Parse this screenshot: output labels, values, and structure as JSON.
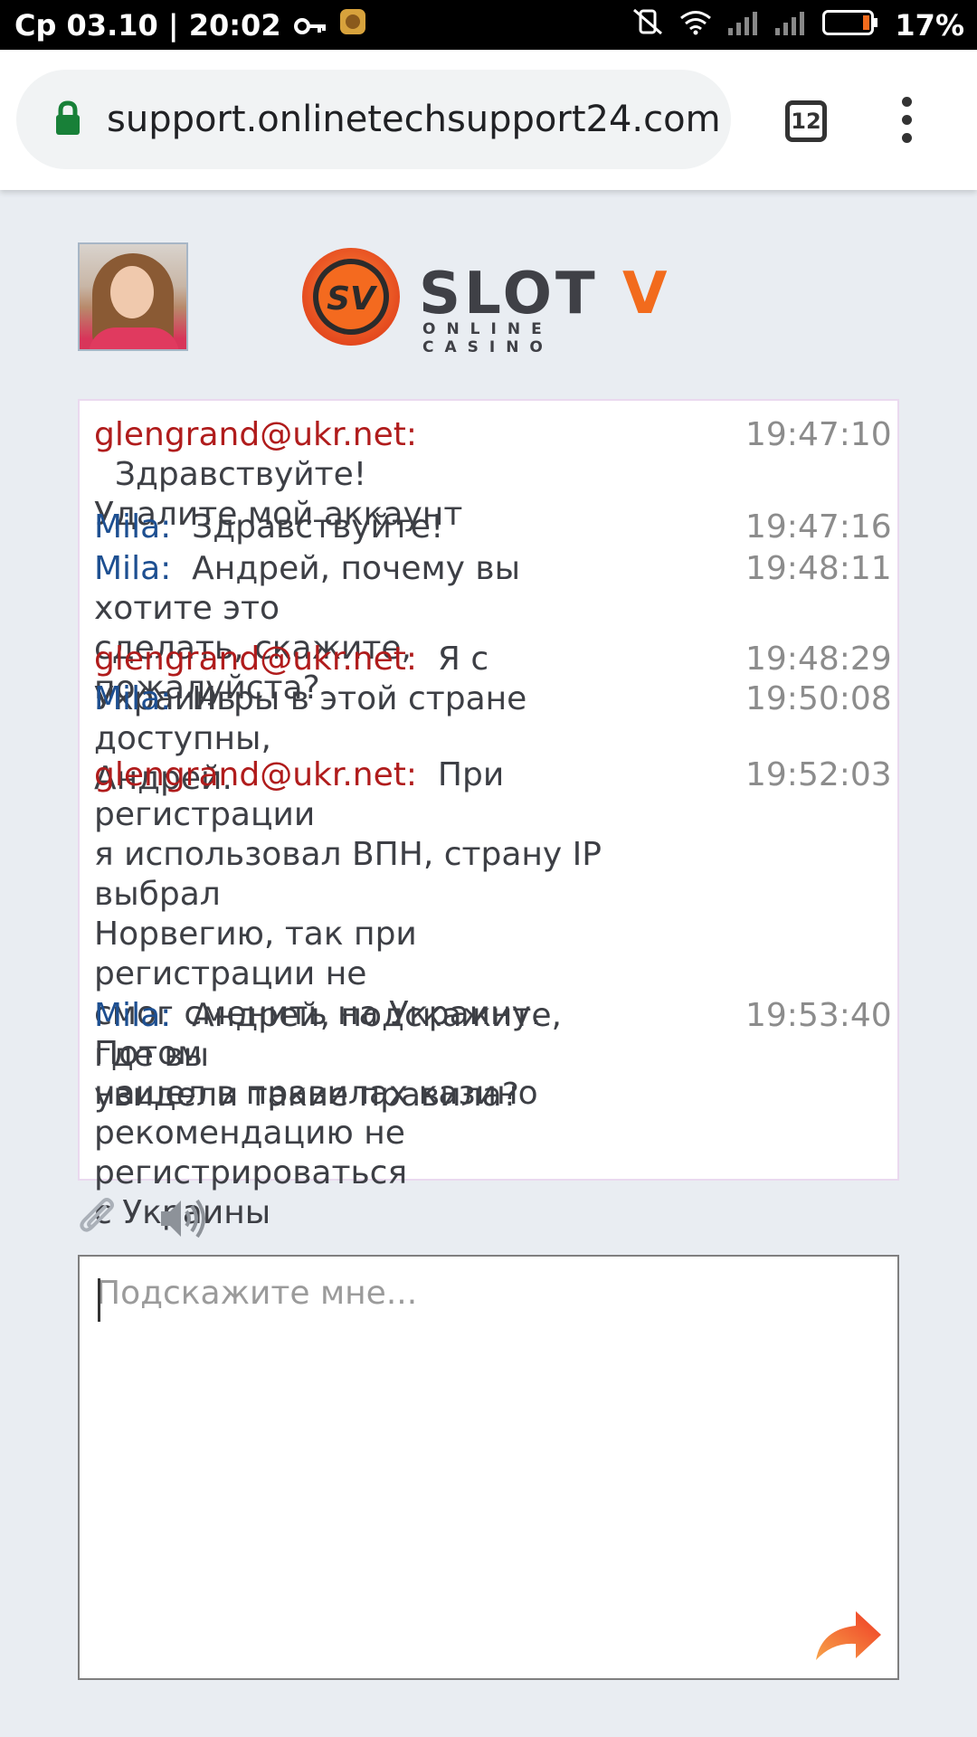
{
  "status_bar": {
    "time": "Ср 03.10 | 20:02",
    "battery": "17%",
    "icons": [
      "key-icon",
      "notification-app-icon",
      "vibrate-off-icon",
      "wifi-icon",
      "signal-icon",
      "signal-icon",
      "battery-icon"
    ]
  },
  "browser": {
    "url": "support.onlinetechsupport24.com",
    "tab_count": "12",
    "icons": [
      "lock-icon",
      "tabs-icon",
      "more-vert-icon"
    ]
  },
  "header": {
    "logo_word": "SLOT",
    "logo_v": "V",
    "logo_sub": "ONLINE CASINO",
    "logo_badge": "SV"
  },
  "chat": {
    "messages": [
      {
        "author": "glengrand@ukr.net:",
        "role": "user",
        "text": "Здравствуйте!",
        "cont": "Удалите мой аккаунт",
        "time": "19:47:10"
      },
      {
        "author": "Mila:",
        "role": "agent",
        "text": "Здравствуйте!",
        "cont": "",
        "time": "19:47:16"
      },
      {
        "author": "Mila:",
        "role": "agent",
        "text": "Андрей, почему вы хотите это",
        "cont": "сделать, скажите, пожалуйста?",
        "time": "19:48:11"
      },
      {
        "author": "glengrand@ukr.net:",
        "role": "user",
        "text": "Я с Украины",
        "cont": "",
        "time": "19:48:29"
      },
      {
        "author": "Mila:",
        "role": "agent",
        "text": "Игры в этой стране доступны,",
        "cont": "Андрей.",
        "time": "19:50:08"
      },
      {
        "author": "glengrand@ukr.net:",
        "role": "user",
        "text": "При регистрации",
        "cont": "я использовал ВПН, страну IP выбрал|Норвегию, так при регистрации не|смог сменить на Украину. Потом|нашел в правилах казино|рекомендацию не регистрироваться|с Украины",
        "time": "19:52:03"
      },
      {
        "author": "Mila:",
        "role": "agent",
        "text": "Андрей, подскажите, где вы",
        "cont": "увидели такие правила?",
        "time": "19:53:40"
      }
    ]
  },
  "tools": {
    "icons": [
      "paperclip-icon",
      "speaker-icon"
    ]
  },
  "input": {
    "placeholder": "Подскажите мне..."
  },
  "send": {
    "icon": "send-arrow-icon"
  },
  "colors": {
    "user": "#b01c1c",
    "agent": "#1d4f91",
    "accent": "#f26b1d",
    "background": "#e9edf2"
  }
}
